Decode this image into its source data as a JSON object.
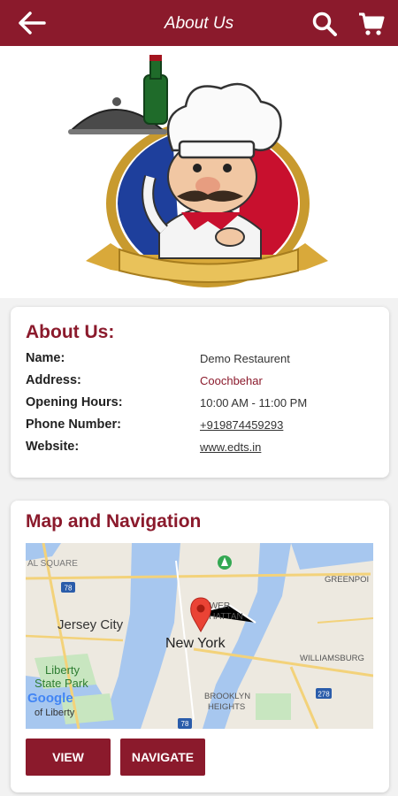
{
  "header": {
    "title": "About Us"
  },
  "about": {
    "heading": "About Us:",
    "rows": [
      {
        "label": "Name:",
        "value": "Demo Restaurent"
      },
      {
        "label": "Address:",
        "value": "Coochbehar"
      },
      {
        "label": "Opening Hours:",
        "value": "10:00 AM - 11:00 PM"
      },
      {
        "label": "Phone Number:",
        "value": "+919874459293"
      },
      {
        "label": "Website:",
        "value": "www.edts.in"
      }
    ]
  },
  "map": {
    "heading": "Map and Navigation",
    "labels": {
      "jersey_city": "Jersey City",
      "new_york": "New York",
      "liberty": "Liberty",
      "state_park": "State Park",
      "of_liberty": "of Liberty",
      "square": "AL SQUARE",
      "lower": "OWER",
      "manhattan": "NHATTAN",
      "greenpoint": "GREENPOI",
      "williamsburg": "WILLIAMSBURG",
      "brooklyn": "BROOKLYN",
      "heights": "HEIGHTS",
      "google": "Google",
      "hw78": "78",
      "hw278": "278",
      "hw78b": "78"
    },
    "view_button": "VIEW",
    "navigate_button": "NAVIGATE"
  },
  "colors": {
    "primary": "#8b1a2c"
  },
  "icons": [
    "back-arrow-icon",
    "search-icon",
    "cart-icon",
    "map-pin-icon",
    "park-pin-icon"
  ]
}
